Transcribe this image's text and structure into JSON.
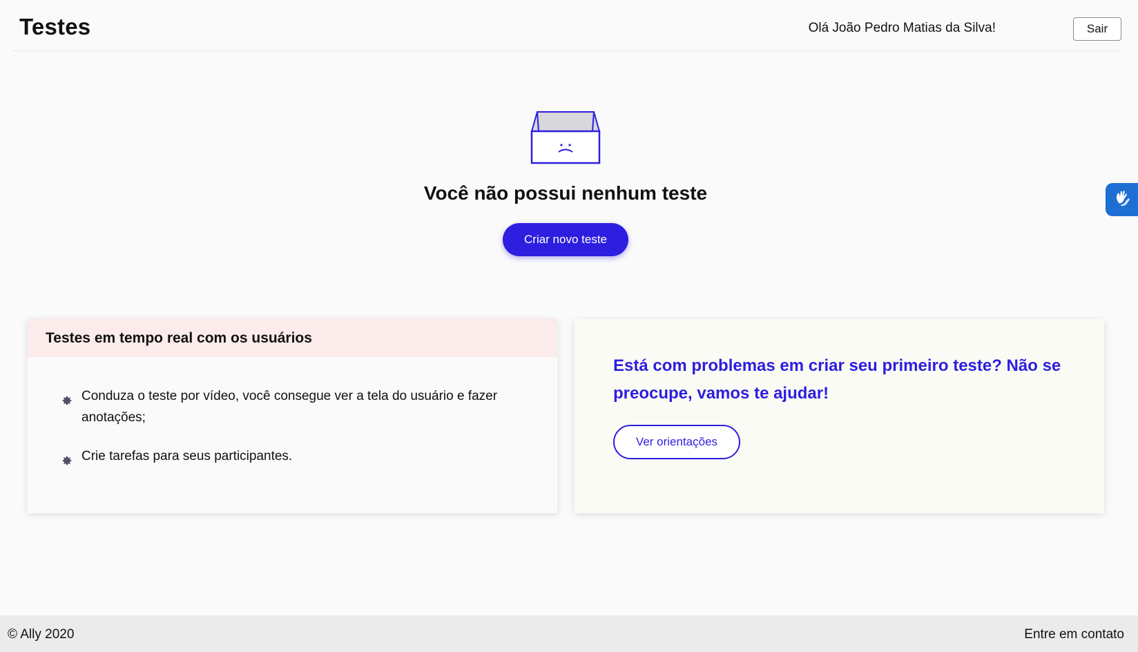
{
  "header": {
    "title": "Testes",
    "greeting": "Olá João Pedro Matias da Silva!",
    "logout_label": "Sair"
  },
  "accessibility_widget": {
    "icon": "sign-language-hands-icon"
  },
  "empty_state": {
    "icon": "empty-box-sad-face-icon",
    "title": "Você não possui nenhum teste",
    "create_button_label": "Criar novo teste"
  },
  "info_card": {
    "title": "Testes em tempo real com os usuários",
    "items": [
      "Conduza o teste por vídeo, você consegue ver a tela do usuário e fazer anotações;",
      "Crie tarefas para seus participantes."
    ]
  },
  "help_card": {
    "text": "Está com problemas em criar seu primeiro teste? Não se preocupe, vamos te ajudar!",
    "button_label": "Ver orientações"
  },
  "footer": {
    "copyright": "© Ally 2020",
    "contact_label": "Entre em contato"
  },
  "colors": {
    "primary": "#2d1ee0",
    "info_card_header_bg": "#fcebeb",
    "help_card_bg": "#fbfbf6",
    "footer_bg": "#ebebeb",
    "accessibility_widget_bg": "#1d6fd4"
  }
}
